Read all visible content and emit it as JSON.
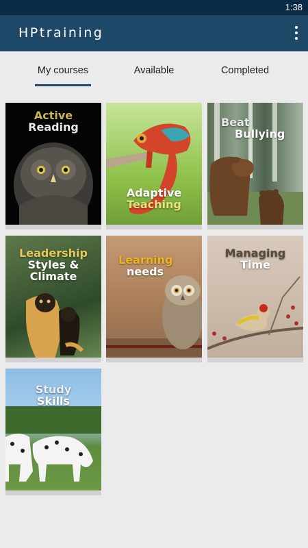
{
  "status_bar": {
    "time": "1:38"
  },
  "app_bar": {
    "title": "HPtraining",
    "menu_icon": "more-vert-icon"
  },
  "tabs": [
    {
      "label": "My courses",
      "selected": true
    },
    {
      "label": "Available",
      "selected": false
    },
    {
      "label": "Completed",
      "selected": false
    }
  ],
  "courses": [
    {
      "title_line1": "Active",
      "title_line2": "Reading",
      "line1_color": "#c9b458",
      "line2_color": "#e8e8e8",
      "image": "owl"
    },
    {
      "title_line1": "Adaptive",
      "title_line2": "Teaching",
      "line1_color": "#ffffff",
      "line2_color": "#e9e27a",
      "image": "chameleon"
    },
    {
      "title_line1": "Beat",
      "title_line2": "Bullying",
      "line1_color": "#e8e8e8",
      "line2_color": "#ffffff",
      "image": "bears"
    },
    {
      "title_line1": "Leadership",
      "title_line2": "Styles &",
      "title_line3": "Climate",
      "line1_color": "#e7c95a",
      "line2_color": "#ffffff",
      "image": "gibbons"
    },
    {
      "title_line1": "Learning",
      "title_line2": "needs",
      "line1_color": "#f0b41a",
      "line2_color": "#ffffff",
      "image": "owl-small"
    },
    {
      "title_line1": "Managing",
      "title_line2": "Time",
      "line1_color": "#5a4a3c",
      "line2_color": "#ffffff",
      "image": "goldfinch"
    },
    {
      "title_line1": "Study",
      "title_line2": "Skills",
      "line1_color": "#e8eef4",
      "line2_color": "#ffffff",
      "image": "dalmatians"
    }
  ]
}
